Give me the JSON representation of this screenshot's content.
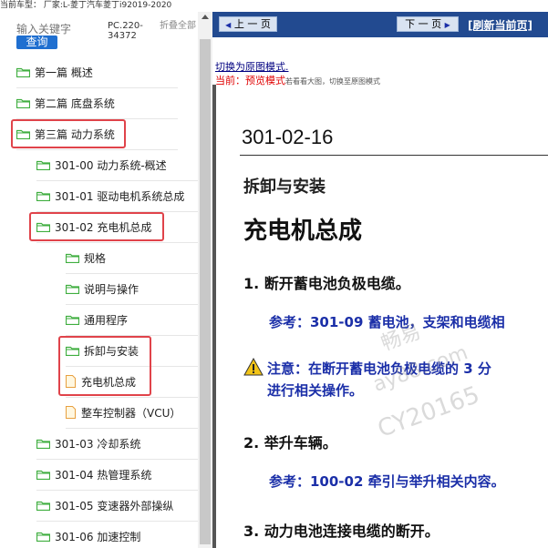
{
  "header": {
    "vehicle_info": "当前车型：  厂家:L-菱丁汽车菱丁i92019-2020"
  },
  "search": {
    "placeholder": "输入关键字",
    "button": "查询"
  },
  "pc_code": "PC.220-34372",
  "collapse_all": "折叠全部",
  "tree": [
    {
      "label": "第一篇 概述",
      "type": "folder",
      "level": 0
    },
    {
      "label": "第二篇 底盘系统",
      "type": "folder",
      "level": 0
    },
    {
      "label": "第三篇 动力系统",
      "type": "folder",
      "level": 0,
      "highlighted": true
    },
    {
      "label": "301-00 动力系统-概述",
      "type": "folder",
      "level": 1
    },
    {
      "label": "301-01 驱动电机系统总成",
      "type": "folder",
      "level": 1
    },
    {
      "label": "301-02 充电机总成",
      "type": "folder",
      "level": 1,
      "highlighted": true
    },
    {
      "label": "规格",
      "type": "folder",
      "level": 2
    },
    {
      "label": "说明与操作",
      "type": "folder",
      "level": 2
    },
    {
      "label": "通用程序",
      "type": "folder",
      "level": 2
    },
    {
      "label": "拆卸与安装",
      "type": "folder",
      "level": 2,
      "highlighted": true
    },
    {
      "label": "充电机总成",
      "type": "doc",
      "level": 2,
      "highlighted": true
    },
    {
      "label": "整车控制器（VCU）",
      "type": "doc",
      "level": 2
    },
    {
      "label": "301-03 冷却系统",
      "type": "folder",
      "level": 1
    },
    {
      "label": "301-04 热管理系统",
      "type": "folder",
      "level": 1
    },
    {
      "label": "301-05 变速器外部操纵",
      "type": "folder",
      "level": 1
    },
    {
      "label": "301-06 加速控制",
      "type": "folder",
      "level": 1
    }
  ],
  "nav": {
    "prev": "上 一 页",
    "next": "下 一 页",
    "refresh": "[刷新当前页]"
  },
  "viewer": {
    "switch_link": "切换为原图模式.",
    "mode_label": "当前：",
    "mode_value": "预览模式",
    "mode_note": "若看看大图，切换至原图模式"
  },
  "document": {
    "code": "301-02-16",
    "section": "拆卸与安装",
    "title": "充电机总成",
    "step1": "1. 断开蓄电池负极电缆。",
    "ref1": "参考：301-09 蓄电池，支架和电缆相",
    "warning_line1": "注意：在断开蓄电池负极电缆的 3 分",
    "warning_line2": "进行相关操作。",
    "step2": "2. 举升车辆。",
    "ref2": "参考：100-02 牵引与举升相关内容。",
    "step3": "3. 动力电池连接电缆的断开。"
  },
  "watermark": {
    "line1": "畅易",
    "line2": "ay88.com",
    "line3": "CY20165"
  },
  "colors": {
    "nav_bg": "#224a90",
    "highlight": "#e0434a",
    "folder": "#3fae3f",
    "link_blue": "#1b2fa8"
  }
}
